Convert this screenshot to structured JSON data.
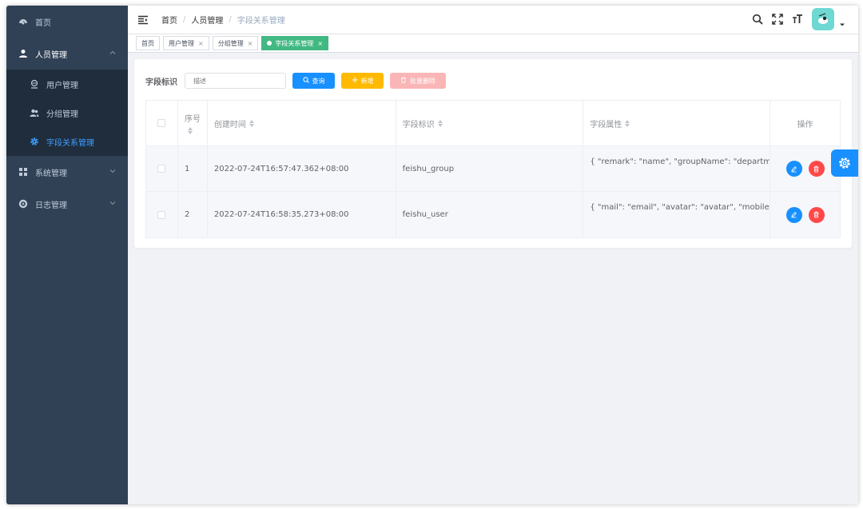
{
  "sidebar": {
    "items": [
      {
        "label": "首页"
      },
      {
        "label": "人员管理",
        "children": [
          {
            "label": "用户管理"
          },
          {
            "label": "分组管理"
          },
          {
            "label": "字段关系管理"
          }
        ]
      },
      {
        "label": "系统管理"
      },
      {
        "label": "日志管理"
      }
    ]
  },
  "navbar": {
    "breadcrumb": [
      "首页",
      "人员管理",
      "字段关系管理"
    ],
    "separator": "/"
  },
  "tags": [
    {
      "label": "首页"
    },
    {
      "label": "用户管理",
      "close": "×"
    },
    {
      "label": "分组管理",
      "close": "×"
    },
    {
      "label": "字段关系管理",
      "close": "×",
      "active": true
    }
  ],
  "search": {
    "label": "字段标识",
    "placeholder": "描述",
    "query_label": "查询",
    "add_label": "新增",
    "batch_delete_label": "批量删除"
  },
  "table": {
    "headers": {
      "seq": "序号",
      "created": "创建时间",
      "field_id": "字段标识",
      "field_attr": "字段属性",
      "ops": "操作"
    },
    "rows": [
      {
        "seq": "1",
        "created": "2022-07-24T16:57:47.362+08:00",
        "field_id": "feishu_group",
        "field_attr": "{ \"remark\": \"name\", \"groupName\": \"department_id\" }"
      },
      {
        "seq": "2",
        "created": "2022-07-24T16:58:35.273+08:00",
        "field_id": "feishu_user",
        "field_attr": "{ \"mail\": \"email\", \"avatar\": \"avatar\", \"mobile\": \"mobile\" }"
      }
    ]
  },
  "colors": {
    "sidebar_bg": "#304156",
    "submenu_bg": "#1f2d3d",
    "active_menu": "#409eff",
    "primary": "#1890ff",
    "warning": "#ffba00",
    "danger_light": "#fab6b6",
    "danger": "#ff4949",
    "tag_active": "#42b983"
  }
}
